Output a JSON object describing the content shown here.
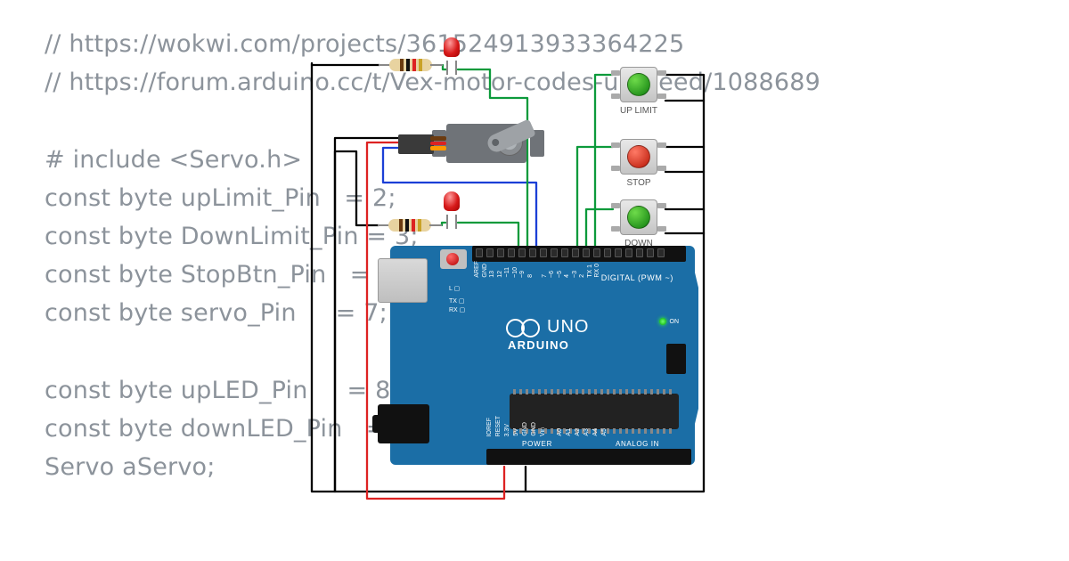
{
  "code": {
    "lines": [
      "// https://wokwi.com/projects/361524913933364225",
      "// https://forum.arduino.cc/t/Vex-motor-codes-up-need/1088689",
      "",
      "# include <Servo.h>",
      "const byte upLimit_Pin   = 2;",
      "const byte DownLimit_Pin = 3;",
      "const byte StopBtn_Pin   = 4;",
      "const byte servo_Pin     = 7;",
      "",
      "const byte upLED_Pin     = 8;",
      "const byte downLED_Pin   = 9;",
      "Servo aServo;"
    ]
  },
  "buttons": {
    "up": {
      "label": "UP LIMIT",
      "color": "green"
    },
    "stop": {
      "label": "STOP",
      "color": "red"
    },
    "down": {
      "label": "DOWN\nLIMIT",
      "color": "green"
    }
  },
  "board": {
    "uno_text": "UNO",
    "arduino_text": "ARDUINO",
    "digital": "DIGITAL (PWM ~)",
    "power": "POWER",
    "analog": "ANALOG IN",
    "on": "ON",
    "l": "L",
    "tx": "TX",
    "rx": "RX",
    "top_pins": [
      "AREF",
      "GND",
      "13",
      "12",
      "~11",
      "~10",
      "~9",
      "8",
      "",
      "7",
      "~6",
      "~5",
      "4",
      "~3",
      "2",
      "TX 1",
      "RX 0"
    ],
    "bot_pins": [
      "IOREF",
      "RESET",
      "3.3V",
      "5V",
      "GND",
      "GND",
      "Vin",
      "",
      "A0",
      "A1",
      "A2",
      "A3",
      "A4",
      "A5"
    ]
  },
  "leds": {
    "top": "red",
    "mid": "red"
  },
  "resistor_bands": [
    "brown",
    "black",
    "red",
    "gold"
  ]
}
